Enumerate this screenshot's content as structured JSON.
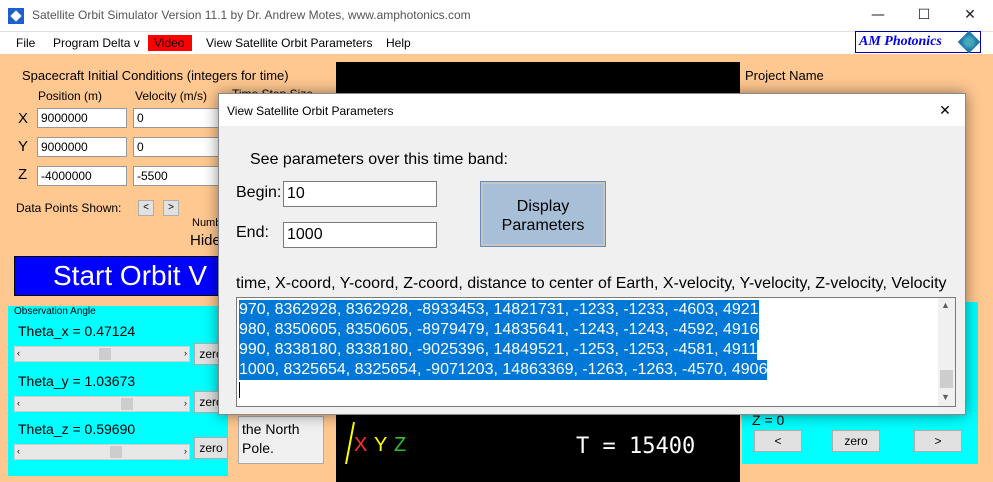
{
  "window": {
    "title": "Satellite Orbit Simulator Version 11.1 by Dr. Andrew Motes, www.amphotonics.com",
    "minimize": "—",
    "maximize": "☐",
    "close": "✕"
  },
  "menu": {
    "items": [
      "File",
      "Program Delta v",
      "Video",
      "View Satellite Orbit Parameters",
      "Help"
    ],
    "logo": "AM Photonics"
  },
  "spacecraft": {
    "section_title": "Spacecraft Initial Conditions (integers for time)",
    "position_header": "Position (m)",
    "velocity_header": "Velocity (m/s)",
    "timestep_header": "Time Step Size",
    "axes": [
      "X",
      "Y",
      "Z"
    ],
    "positions": [
      "9000000",
      "9000000",
      "-4000000"
    ],
    "velocities": [
      "0",
      "0",
      "-5500"
    ],
    "data_points_label": "Data Points Shown:",
    "prev_btn": "<",
    "next_btn": ">",
    "number_label": "Numbe",
    "hide_label": "Hide",
    "start_button": "Start Orbit V"
  },
  "observation": {
    "title": "Observation Angle",
    "theta_x": "Theta_x = 0.47124",
    "theta_y": "Theta_y = 1.03673",
    "theta_z": "Theta_z = 0.59690",
    "zero_label": "zero",
    "slider_x_fraction": 0.52,
    "slider_y_fraction": 0.68,
    "slider_z_fraction": 0.6,
    "north_pole_text": "the North Pole."
  },
  "visualization": {
    "axis_labels": [
      "X",
      "Y",
      "Z"
    ],
    "axis_colors": [
      "#ff3030",
      "#ffff00",
      "#30c030"
    ],
    "time_readout": "T = 15400"
  },
  "right_panel": {
    "project_name_label": "Project Name",
    "z_readout": "Z = 0",
    "prev_btn": "<",
    "zero_btn": "zero",
    "next_btn": ">"
  },
  "dialog": {
    "title": "View Satellite Orbit Parameters",
    "close": "✕",
    "prompt": "See parameters over this time band:",
    "begin_label": "Begin:",
    "begin_value": "10",
    "end_label": "End:",
    "end_value": "1000",
    "display_button": "Display Parameters",
    "columns_header": "time, X-coord, Y-coord, Z-coord, distance to center of Earth, X-velocity, Y-velocity, Z-velocity, Velocity",
    "results": [
      "970, 8362928, 8362928, -8933453, 14821731, -1233, -1233, -4603, 4921",
      "980, 8350605, 8350605, -8979479, 14835641, -1243, -1243, -4592, 4916",
      "990, 8338180, 8338180, -9025396, 14849521, -1253, -1253, -4581, 4911",
      "1000, 8325654, 8325654, -9071203, 14863369, -1263, -1263, -4570, 4906"
    ],
    "scroll_up": "▲",
    "scroll_down": "▼"
  }
}
